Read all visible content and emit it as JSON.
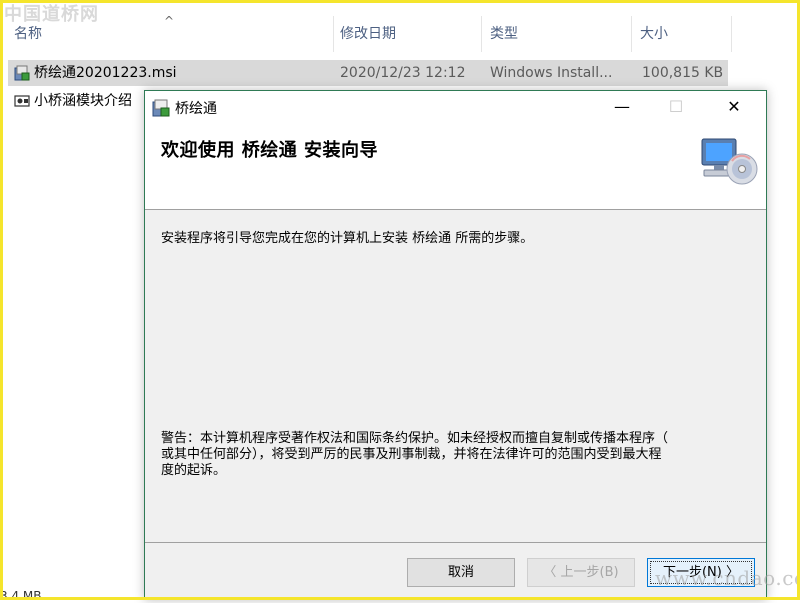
{
  "watermark": {
    "top": "中国道桥网",
    "bottom": "www.cndao.com"
  },
  "explorer": {
    "columns": {
      "name": "名称",
      "modified": "修改日期",
      "type": "类型",
      "size": "大小"
    },
    "files": [
      {
        "name": "桥绘通20201223.msi",
        "modified": "2020/12/23 12:12",
        "type": "Windows Install...",
        "size": "100,815 KB"
      },
      {
        "name": "小桥涵模块介绍",
        "modified": "",
        "type": "",
        "size": ""
      }
    ],
    "status_fragment": "3.4 MB"
  },
  "dialog": {
    "window_title": "桥绘通",
    "banner_title": "欢迎使用  桥绘通  安装向导",
    "intro": "安装程序将引导您完成在您的计算机上安装 桥绘通 所需的步骤。",
    "warning_line1": "警告：本计算机程序受著作权法和国际条约保护。如未经授权而擅自复制或传播本程序（",
    "warning_line2": "或其中任何部分），将受到严厉的民事及刑事制裁，并将在法律许可的范围内受到最大程",
    "warning_line3": "度的起诉。",
    "buttons": {
      "cancel": "取消",
      "back": "〈 上一步(B)",
      "next": "下一步(N) 〉"
    },
    "titlebar_controls": {
      "minimize": "—",
      "maximize": "☐",
      "close": "✕"
    }
  },
  "colors": {
    "dialog_border": "#2f7a55",
    "frame": "#f5e52c",
    "selection": "#d9d9d9"
  },
  "icons": [
    "installer-package-icon",
    "computer-cd-icon",
    "sort-ascending-icon"
  ]
}
